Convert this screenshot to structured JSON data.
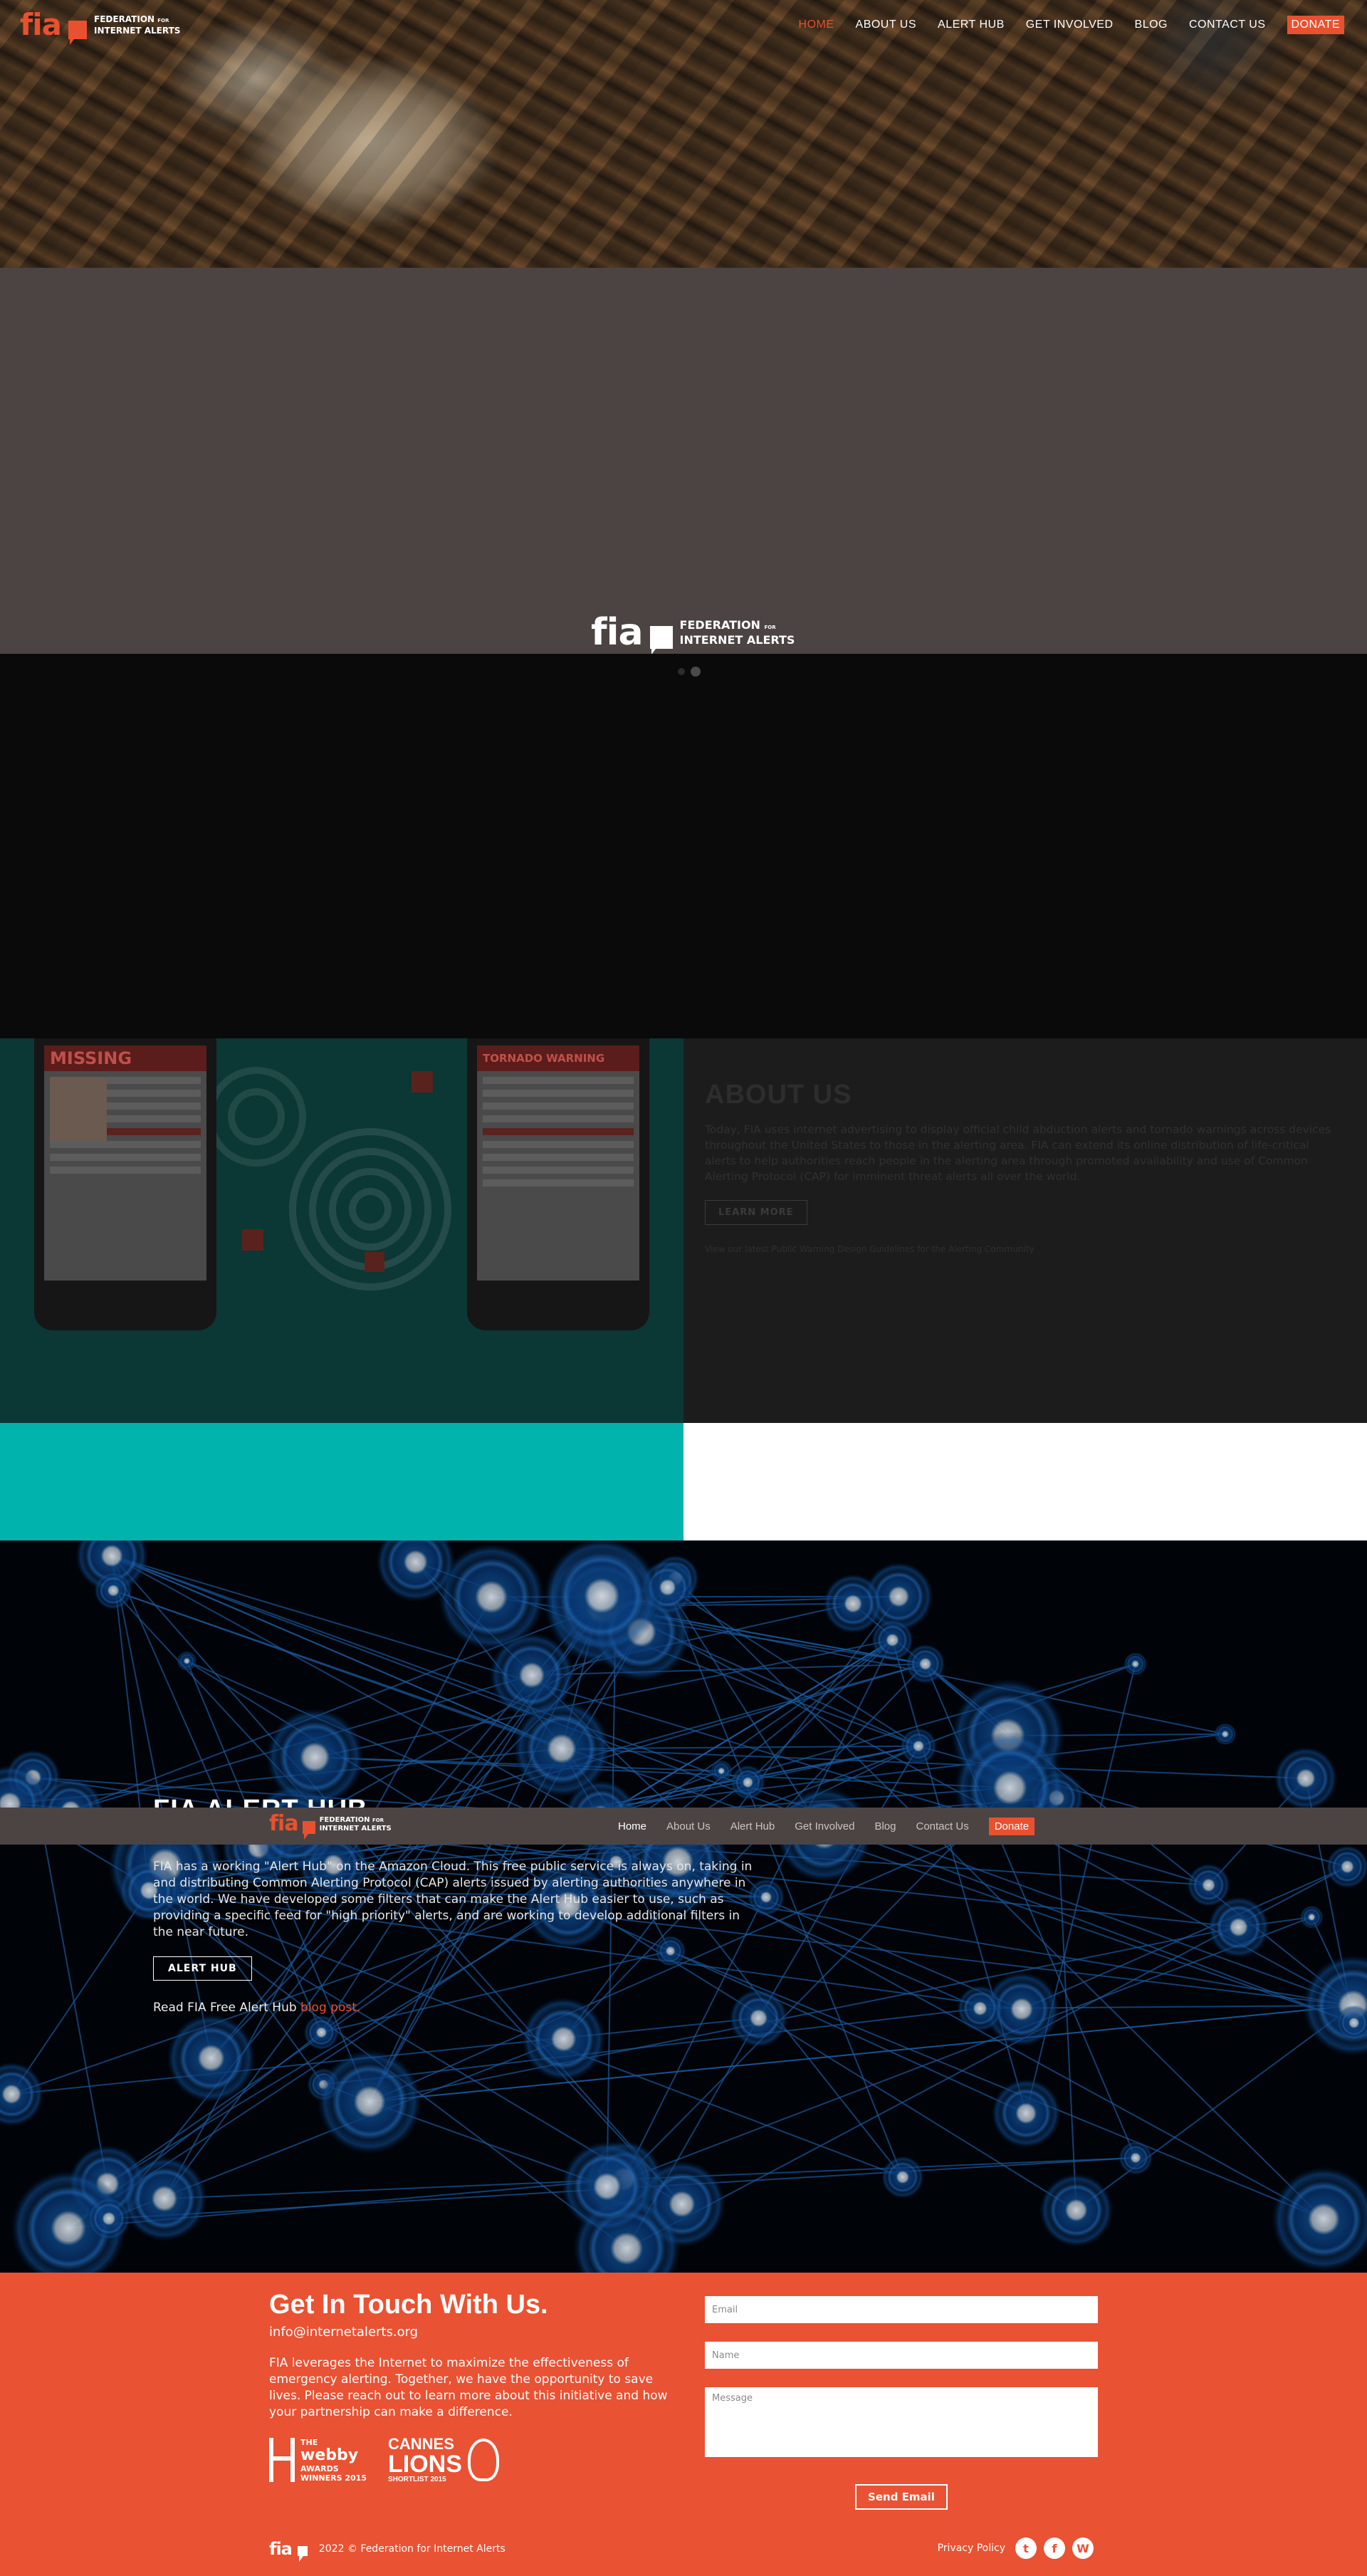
{
  "brand": {
    "short": "fia",
    "full_line1": "FEDERATION",
    "full_for": "FOR",
    "full_line2": "INTERNET ALERTS",
    "accent": "#e8512f"
  },
  "topnav": {
    "items": [
      "HOME",
      "ABOUT US",
      "ALERT HUB",
      "GET INVOLVED",
      "BLOG",
      "CONTACT US"
    ],
    "donate": "DONATE",
    "active_index": 0
  },
  "slider": {
    "dots": 2,
    "active": 1
  },
  "about": {
    "title": "ABOUT US",
    "body": "Today, FIA uses internet advertising to display official child abduction alerts and tornado warnings across devices throughout the United States to those in the alerting area. FIA can extend its online distribution of life-critical alerts to help authorities reach people in the alerting area through promoted availability and use of Common Alerting Protocol (CAP) for imminent threat alerts all over the world.",
    "button": "LEARN MORE",
    "note": "View our latest Public Warning Design Guidelines for the Alerting Community",
    "phone1_header": "MISSING",
    "phone2_header": "TORNADO WARNING"
  },
  "alert_hub": {
    "title": "FIA ALERT HUB",
    "body": "FIA has a working \"Alert Hub\" on the Amazon Cloud. This free public service is always on, taking in and distributing Common Alerting Protocol (CAP) alerts issued by alerting authorities anywhere in the world. We have developed some filters that can make the Alert Hub easier to use, such as providing a specific feed for \"high priority\" alerts, and are working to develop additional filters in the near future.",
    "button": "ALERT HUB",
    "read_prefix": "Read FIA Free Alert Hub ",
    "read_link": "blog post."
  },
  "sticky_nav": {
    "items": [
      "Home",
      "About Us",
      "Alert Hub",
      "Get Involved",
      "Blog",
      "Contact Us"
    ],
    "donate": "Donate",
    "active_index": 0
  },
  "contact": {
    "title": "Get In Touch With Us.",
    "email": "info@internetalerts.org",
    "text": "FIA leverages the Internet to maximize the effectiveness of emergency alerting. Together, we have the opportunity to save lives. Please reach out to learn more about this initiative and how your partnership can make a difference.",
    "placeholder_email": "Email",
    "placeholder_name": "Name",
    "placeholder_message": "Message",
    "send": "Send Email",
    "webby_the": "THE",
    "webby_name": "webby",
    "webby_awards": "AWARDS",
    "webby_winners": "WINNERS 2015",
    "lions_1": "CANNES",
    "lions_2": "LIONS",
    "lions_3": "SHORTLIST 2015"
  },
  "footer": {
    "copyright": "2022 © Federation for Internet Alerts",
    "privacy": "Privacy Policy",
    "social": [
      "twitter-icon",
      "facebook-icon",
      "wordpress-icon"
    ]
  },
  "colors": {
    "accent": "#e8512f",
    "contact_bg": "#e95233",
    "brown_band": "#4b4443",
    "teal": "#00b3ad"
  }
}
